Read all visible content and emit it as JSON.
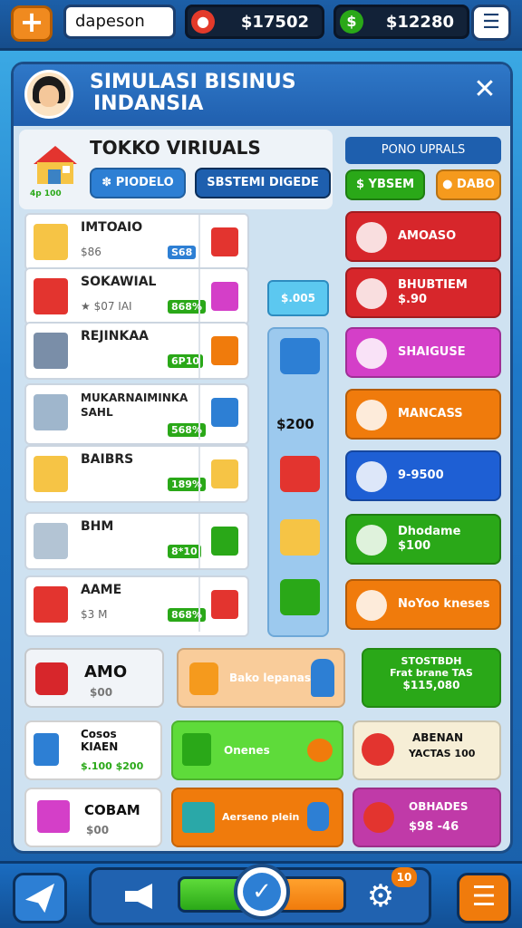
{
  "topbar": {
    "player_name": "dapeson",
    "coins": "$17502",
    "cash": "$12280"
  },
  "panel": {
    "title_line1": "SIMULASI BISINUS",
    "title_line2": "INDANSIA",
    "shop_title": "TOKKO VIRIUALS",
    "shop_caption": "4p 100",
    "tab_products": "PIODELO",
    "tab_system": "SBSTEMI DIGEDE",
    "right_header": "PONO UPRALS",
    "btn_green": "YBSEM",
    "btn_orange": "DABO"
  },
  "rows": [
    {
      "name": "IMTOAIO",
      "sub": "$86",
      "badge": "S68"
    },
    {
      "name": "SOKAWIAL",
      "sub": "★ $07 IAI",
      "badge": "868%"
    },
    {
      "name": "REJINKAA",
      "sub": "",
      "badge": "6P10"
    },
    {
      "name": "MUKARNAIMINKA SAHL",
      "sub": "",
      "badge": "568%"
    },
    {
      "name": "BAIBRS",
      "sub": "",
      "badge": "189%"
    },
    {
      "name": "BHM",
      "sub": "",
      "badge": "8*10"
    },
    {
      "name": "AAME",
      "sub": "$3 M",
      "badge": "868%"
    }
  ],
  "mid": {
    "top_value": "$.005",
    "value": "$200"
  },
  "actions": [
    {
      "label": "AMOASO",
      "color": "#d7262b"
    },
    {
      "label": "BHUBTIEM\n$.90",
      "color": "#d7262b"
    },
    {
      "label": "SHAIGUSE",
      "color": "#d43fc8"
    },
    {
      "label": "MANCASS",
      "color": "#f07b0c"
    },
    {
      "label": "9-9500",
      "color": "#1e5fd4"
    },
    {
      "label": "Dhodame\n$100",
      "color": "#2aa818"
    },
    {
      "label": "NoYoo kneses",
      "color": "#f07b0c"
    }
  ],
  "bottom": {
    "amo_title": "AMO",
    "amo_value": "$00",
    "promo": "Bako lepanas",
    "stock_title": "STOSTBDH",
    "stock_line2": "Frat brane TAS",
    "stock_value": "$115,080",
    "cases_title": "Cosos",
    "cases_sub": "KIAEN",
    "cases_values": "$.100 $200",
    "onenes": "Onenes",
    "abenan": "ABENAN",
    "yactas": "YACTAS 100",
    "cobam": "COBAM",
    "cobam_value": "$00",
    "basket": "Aerseno plein",
    "obhades": "OBHADES",
    "obhades_value": "$98 -46"
  },
  "bottombar": {
    "notif_count": "10",
    "progress": 0.5
  }
}
